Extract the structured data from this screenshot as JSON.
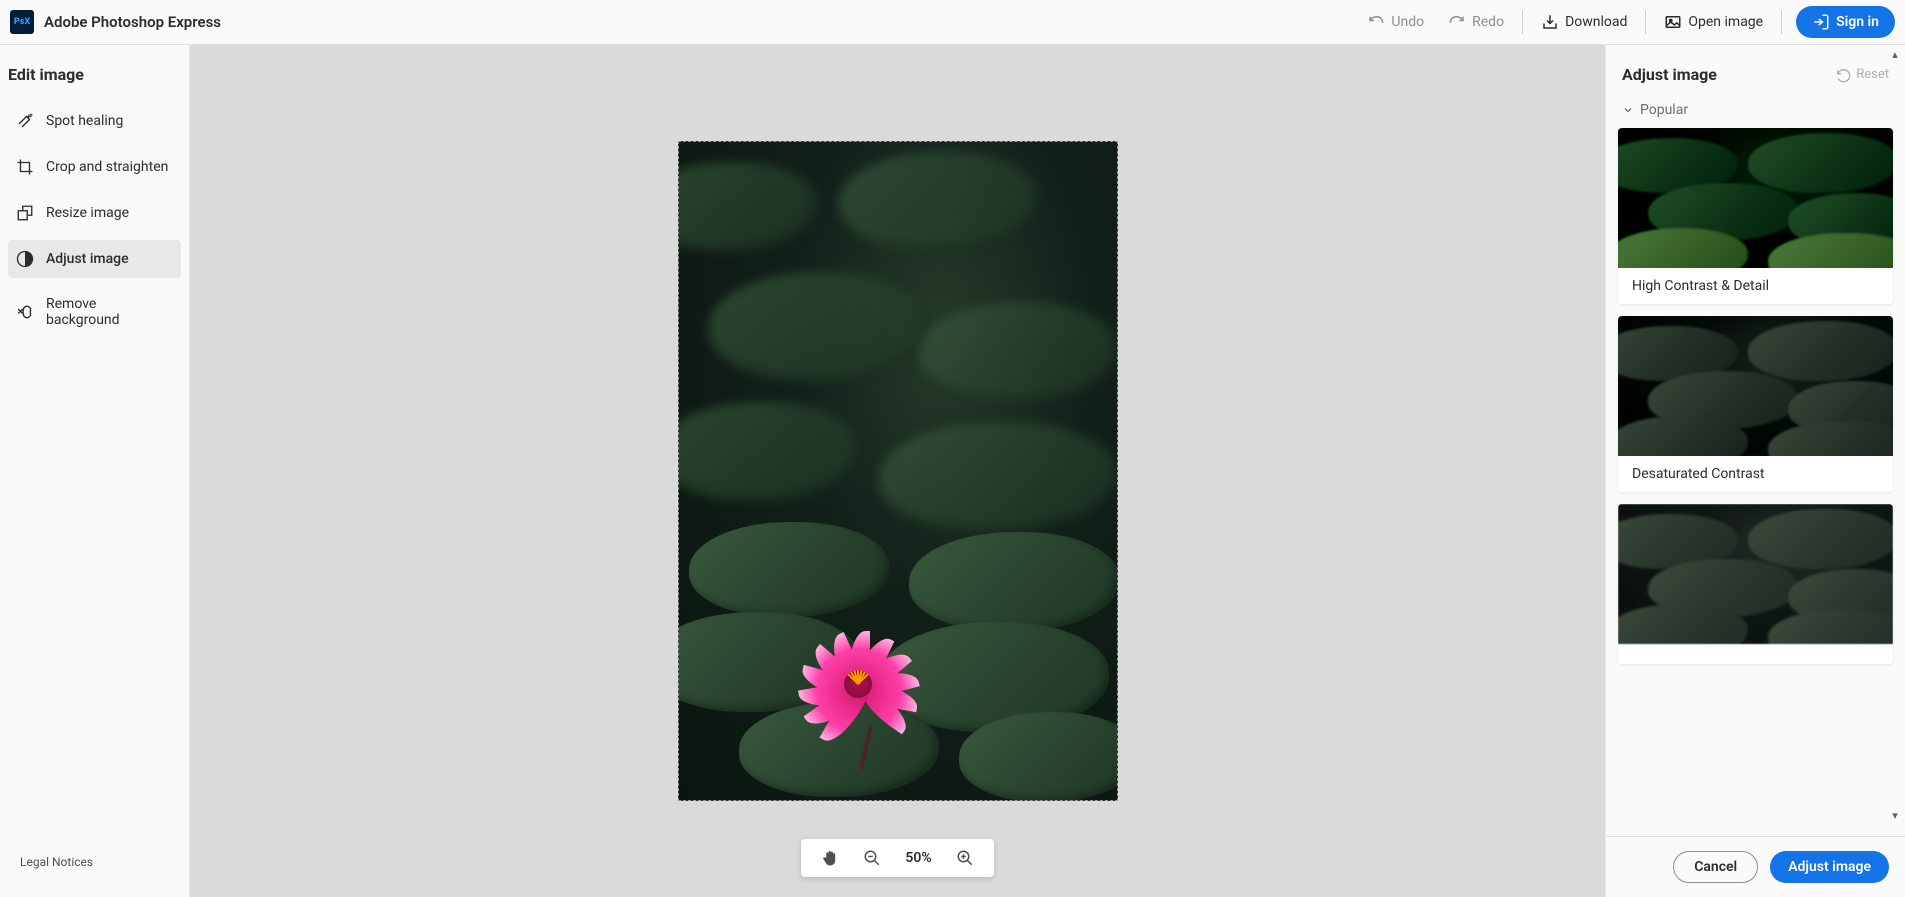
{
  "app": {
    "title": "Adobe Photoshop Express",
    "logo_text": "PsX"
  },
  "header": {
    "undo": "Undo",
    "redo": "Redo",
    "download": "Download",
    "open_image": "Open image",
    "sign_in": "Sign in"
  },
  "left": {
    "title": "Edit image",
    "items": [
      {
        "label": "Spot healing"
      },
      {
        "label": "Crop and straighten"
      },
      {
        "label": "Resize image"
      },
      {
        "label": "Adjust image"
      },
      {
        "label": "Remove background"
      }
    ],
    "legal": "Legal Notices"
  },
  "canvas": {
    "zoom": "50%"
  },
  "right": {
    "title": "Adjust image",
    "reset": "Reset",
    "section": "Popular",
    "presets": [
      {
        "label": "High Contrast & Detail"
      },
      {
        "label": "Desaturated Contrast"
      },
      {
        "label": ""
      }
    ],
    "cancel": "Cancel",
    "apply": "Adjust image"
  }
}
